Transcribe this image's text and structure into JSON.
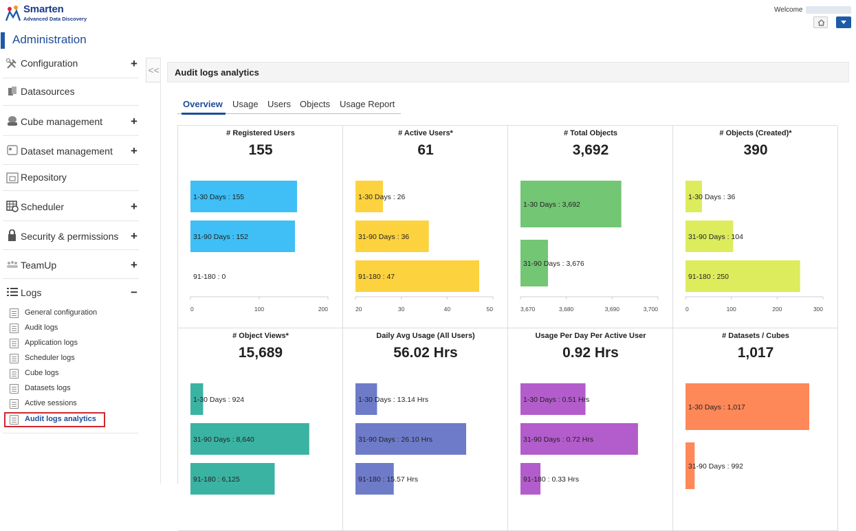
{
  "header": {
    "brand": "Smarten",
    "tagline": "Advanced Data Discovery",
    "welcome": "Welcome",
    "icons": [
      "logo-icon",
      "home-icon",
      "dropdown-icon"
    ]
  },
  "admin_title": "Administration",
  "sidebar": {
    "items": [
      {
        "label": "Configuration",
        "icon": "tools-icon",
        "toggle": "+"
      },
      {
        "label": "Datasources",
        "icon": "database-icon",
        "toggle": ""
      },
      {
        "label": "Cube management",
        "icon": "cube-icon",
        "toggle": "+"
      },
      {
        "label": "Dataset management",
        "icon": "dataset-icon",
        "toggle": "+"
      },
      {
        "label": "Repository",
        "icon": "repository-icon",
        "toggle": ""
      },
      {
        "label": "Scheduler",
        "icon": "calendar-icon",
        "toggle": "+"
      },
      {
        "label": "Security & permissions",
        "icon": "lock-icon",
        "toggle": "+"
      },
      {
        "label": "TeamUp",
        "icon": "team-icon",
        "toggle": "+"
      },
      {
        "label": "Logs",
        "icon": "list-icon",
        "toggle": "−"
      }
    ],
    "log_items": [
      "General configuration",
      "Audit logs",
      "Application logs",
      "Scheduler logs",
      "Cube logs",
      "Datasets logs",
      "Active sessions",
      "Audit logs analytics"
    ],
    "collapse_glyph": "<<"
  },
  "main": {
    "panel_title": "Audit logs analytics",
    "tabs": [
      "Overview",
      "Usage",
      "Users",
      "Objects",
      "Usage Report"
    ],
    "active_tab": "Overview"
  },
  "colors": {
    "blue": "#3fbff5",
    "yellow": "#fdd23f",
    "green": "#73c674",
    "lime": "#dcec5c",
    "teal": "#3ab3a3",
    "indigo": "#6e7bc9",
    "purple": "#b35ccb",
    "orange": "#ff8859"
  },
  "chart_data": [
    {
      "type": "bar",
      "title": "# Registered Users",
      "headline": "155",
      "color": "#3fbff5",
      "categories": [
        "1-30 Days",
        "31-90 Days",
        "91-180"
      ],
      "values": [
        155,
        152,
        0
      ],
      "labels": [
        "1-30 Days : 155",
        "31-90 Days : 152",
        "91-180 : 0"
      ],
      "xlim": [
        0,
        200
      ],
      "ticks": [
        "0",
        "100",
        "200"
      ]
    },
    {
      "type": "bar",
      "title": "# Active Users*",
      "headline": "61",
      "color": "#fdd23f",
      "categories": [
        "1-30 Days",
        "31-90 Days",
        "91-180"
      ],
      "values": [
        26,
        36,
        47
      ],
      "labels": [
        "1-30 Days : 26",
        "31-90 Days : 36",
        "91-180 : 47"
      ],
      "xlim": [
        20,
        50
      ],
      "ticks": [
        "20",
        "30",
        "40",
        "50"
      ]
    },
    {
      "type": "bar",
      "title": "# Total Objects",
      "headline": "3,692",
      "color": "#73c674",
      "categories": [
        "1-30 Days",
        "31-90 Days"
      ],
      "values": [
        3692,
        3676
      ],
      "labels": [
        "1-30 Days : 3,692",
        "31-90 Days : 3,676"
      ],
      "xlim": [
        3670,
        3700
      ],
      "ticks": [
        "3,670",
        "3,680",
        "3,690",
        "3,700"
      ]
    },
    {
      "type": "bar",
      "title": "# Objects (Created)*",
      "headline": "390",
      "color": "#dcec5c",
      "categories": [
        "1-30 Days",
        "31-90 Days",
        "91-180"
      ],
      "values": [
        36,
        104,
        250
      ],
      "labels": [
        "1-30 Days : 36",
        "31-90 Days : 104",
        "91-180 : 250"
      ],
      "xlim": [
        0,
        300
      ],
      "ticks": [
        "0",
        "100",
        "200",
        "300"
      ]
    },
    {
      "type": "bar",
      "title": "# Object Views*",
      "headline": "15,689",
      "color": "#3ab3a3",
      "categories": [
        "1-30 Days",
        "31-90 Days",
        "91-180"
      ],
      "values": [
        924,
        8640,
        6125
      ],
      "labels": [
        "1-30 Days : 924",
        "31-90 Days : 8,640",
        "91-180 : 6,125"
      ],
      "xlim": [
        0,
        10000
      ],
      "ticks": []
    },
    {
      "type": "bar",
      "title": "Daily Avg Usage (All Users)",
      "headline": "56.02 Hrs",
      "color": "#6e7bc9",
      "categories": [
        "1-30 Days",
        "31-90 Days",
        "91-180"
      ],
      "values": [
        13.14,
        26.1,
        15.57
      ],
      "labels": [
        "1-30 Days : 13.14 Hrs",
        "31-90 Days : 26.10 Hrs",
        "91-180 : 15.57 Hrs"
      ],
      "xlim": [
        10,
        30
      ],
      "ticks": []
    },
    {
      "type": "bar",
      "title": "Usage Per Day Per Active User",
      "headline": "0.92 Hrs",
      "color": "#b35ccb",
      "categories": [
        "1-30 Days",
        "31-90 Days",
        "91-180"
      ],
      "values": [
        0.51,
        0.72,
        0.33
      ],
      "labels": [
        "1-30 Days : 0.51 Hrs",
        "31-90 Days : 0.72 Hrs",
        "91-180 : 0.33 Hrs"
      ],
      "xlim": [
        0.25,
        0.8
      ],
      "ticks": []
    },
    {
      "type": "bar",
      "title": "# Datasets / Cubes",
      "headline": "1,017",
      "color": "#ff8859",
      "categories": [
        "1-30 Days",
        "31-90 Days"
      ],
      "values": [
        1017,
        992
      ],
      "labels": [
        "1-30 Days : 1,017",
        "31-90 Days : 992"
      ],
      "xlim": [
        990,
        1020
      ],
      "ticks": []
    }
  ]
}
